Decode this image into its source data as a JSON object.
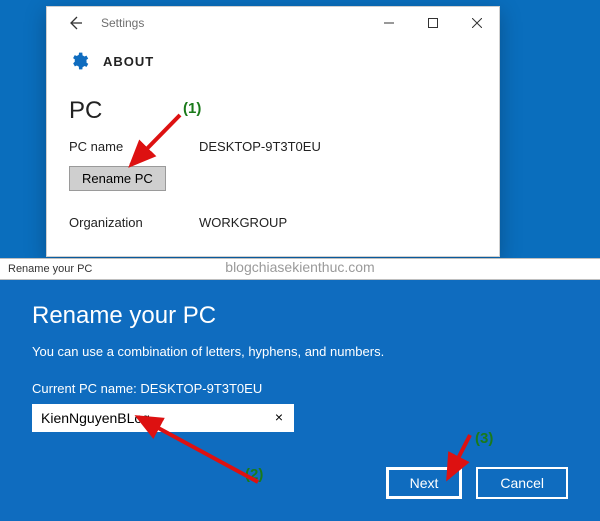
{
  "settings": {
    "title": "Settings",
    "section": "ABOUT",
    "pc_heading": "PC",
    "pc_name_label": "PC name",
    "pc_name_value": "DESKTOP-9T3T0EU",
    "rename_btn": "Rename PC",
    "org_label": "Organization",
    "org_value": "WORKGROUP"
  },
  "dlg_titlebar": "Rename your PC",
  "watermark": "blogchiasekienthuc.com",
  "dialog": {
    "heading": "Rename your PC",
    "subtext": "You can use a combination of letters, hyphens, and numbers.",
    "current_label": "Current PC name: DESKTOP-9T3T0EU",
    "input_value": "KienNguyenBLog",
    "next": "Next",
    "cancel": "Cancel"
  },
  "annotations": {
    "a1": "(1)",
    "a2": "(2)",
    "a3": "(3)"
  }
}
